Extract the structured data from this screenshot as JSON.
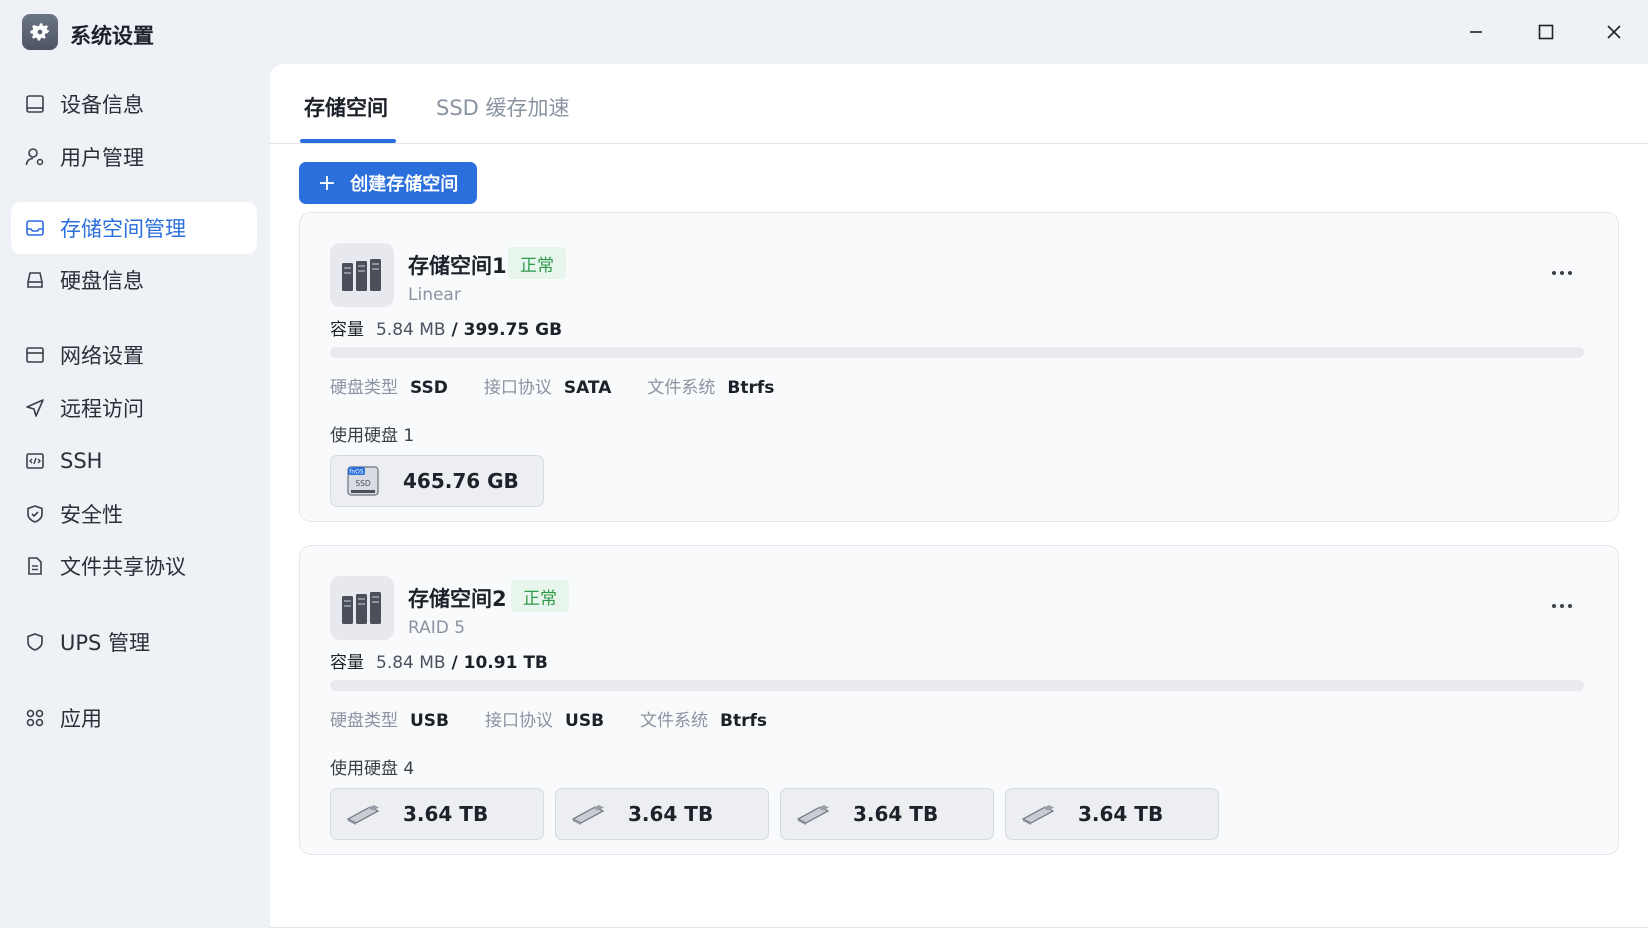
{
  "app": {
    "title": "系统设置"
  },
  "sidebar": {
    "items": [
      {
        "label": "设备信息",
        "icon": "monitor-icon"
      },
      {
        "label": "用户管理",
        "icon": "user-gear-icon"
      },
      {
        "label": "存储空间管理",
        "icon": "storage-icon",
        "active": true
      },
      {
        "label": "硬盘信息",
        "icon": "hard-drive-icon"
      },
      {
        "label": "网络设置",
        "icon": "network-icon"
      },
      {
        "label": "远程访问",
        "icon": "send-icon"
      },
      {
        "label": "SSH",
        "icon": "code-icon"
      },
      {
        "label": "安全性",
        "icon": "shield-check-icon"
      },
      {
        "label": "文件共享协议",
        "icon": "file-icon"
      },
      {
        "label": "UPS 管理",
        "icon": "shield-icon"
      },
      {
        "label": "应用",
        "icon": "apps-icon"
      }
    ]
  },
  "tabs": {
    "active": "存储空间",
    "inactive": "SSD 缓存加速"
  },
  "toolbar": {
    "create_label": "创建存储空间",
    "create_icon": "+"
  },
  "pools": [
    {
      "name": "存储空间1",
      "status": "正常",
      "type": "Linear",
      "capacity_label": "容量",
      "used": "5.84 MB",
      "separator": " / ",
      "total": "399.75 GB",
      "usage_fraction": 0.0,
      "disk_type_label": "硬盘类型",
      "disk_type": "SSD",
      "protocol_label": "接口协议",
      "protocol": "SATA",
      "fs_label": "文件系统",
      "fs": "Btrfs",
      "disks_label": "使用硬盘 1",
      "disks": [
        {
          "capacity": "465.76 GB",
          "icon": "ssd-icon",
          "icon_text_top": "fnOS",
          "icon_text": "SSD"
        }
      ]
    },
    {
      "name": "存储空间2",
      "status": "正常",
      "type": "RAID 5",
      "capacity_label": "容量",
      "used": "5.84 MB",
      "separator": " / ",
      "total": "10.91 TB",
      "usage_fraction": 0.0,
      "disk_type_label": "硬盘类型",
      "disk_type": "USB",
      "protocol_label": "接口协议",
      "protocol": "USB",
      "fs_label": "文件系统",
      "fs": "Btrfs",
      "disks_label": "使用硬盘 4",
      "disks": [
        {
          "capacity": "3.64 TB",
          "icon": "usb-drive-icon"
        },
        {
          "capacity": "3.64 TB",
          "icon": "usb-drive-icon"
        },
        {
          "capacity": "3.64 TB",
          "icon": "usb-drive-icon"
        },
        {
          "capacity": "3.64 TB",
          "icon": "usb-drive-icon"
        }
      ]
    }
  ],
  "colors": {
    "accent": "#2a6fdb",
    "status_ok": "#2f9a4a",
    "status_ok_bg": "#e8f5ec"
  }
}
